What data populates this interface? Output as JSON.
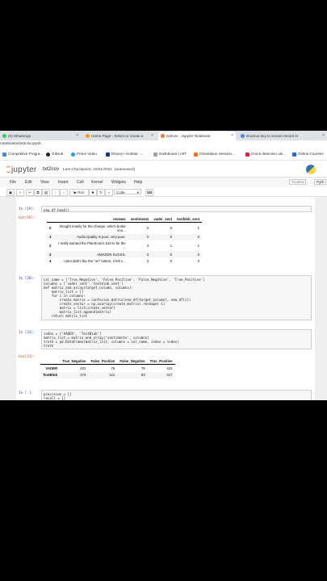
{
  "browser": {
    "tabs": [
      {
        "label": "(6) WhatsApp",
        "color": "#25d366"
      },
      {
        "label": "Home Page - Select or create a",
        "color": "#f59e0b"
      },
      {
        "label": "txt2csv - Jupyter Notebook",
        "color": "#f37626"
      },
      {
        "label": "shortcut key to screen record in",
        "color": "#4285f4"
      }
    ],
    "url": "notebooks/txt2csv.ipynb",
    "bookmarks": [
      {
        "label": "Competitive Progra...",
        "color": "#4285f4"
      },
      {
        "label": "GitHub",
        "color": "#222222"
      },
      {
        "label": "Prime Video",
        "color": "#1a98ff"
      },
      {
        "label": "Disney+ Hotstar -...",
        "color": "#0c3b8c"
      },
      {
        "label": "Dashboard | eIIT",
        "color": "#9ca3af"
      },
      {
        "label": "Orientation Session...",
        "color": "#f97316"
      },
      {
        "label": "Crack detection usi...",
        "color": "#e11d48"
      },
      {
        "label": "Online Courses",
        "color": "#2563eb"
      }
    ]
  },
  "jupyter": {
    "logo": "jupyter",
    "notebook_name": "txt2csv",
    "checkpoint": "Last Checkpoint: 10/01/2021",
    "autosave": "(autosaved)",
    "menus": [
      "File",
      "Edit",
      "View",
      "Insert",
      "Cell",
      "Kernel",
      "Widgets",
      "Help"
    ],
    "trusted": "Trusted",
    "kernel": "Pyth",
    "run_label": "▶ Run",
    "cell_type": "Code"
  },
  "cells": {
    "c19_in": "In [19]:",
    "c19_code": "new_df.head()",
    "c19_out": "Out[19]:",
    "head_table": {
      "columns": [
        "reviews",
        "sentiments",
        "vader_sent",
        "textblob_sent"
      ],
      "rows": [
        {
          "idx": "0",
          "cells": [
            "Bought mainly for the charger, which broke soo...",
            "0",
            "0",
            "1"
          ]
        },
        {
          "idx": "1",
          "cells": [
            "Audio Quality is poor, very poor.",
            "0",
            "0",
            "0"
          ]
        },
        {
          "idx": "2",
          "cells": [
            "I really wanted the Plantronics 510 to be the ...",
            "0",
            "1",
            "1"
          ]
        },
        {
          "idx": "3",
          "cells": [
            "AMAZON SUCKS.",
            "0",
            "0",
            "0"
          ]
        },
        {
          "idx": "4",
          "cells": [
            "I also didn't like the \"on\" button, it felt s...",
            "0",
            "0",
            "0"
          ]
        }
      ]
    },
    "c20_in": "In [20]:",
    "c20_lines": [
      "col_name = ['True_Negative', 'False_Positive', 'False_Negative', 'True_Positive']",
      "columns = ['vader_sent','textblob_sent']",
      "def matrix_and_array(target_column, columns):",
      "    matrix_list = []",
      "    for i in columns:",
      "        create_matrix = confusion_matrix(new_df[target_column], new_df[i])",
      "        create_vector = np.asarray(create_matrix).reshape(-1)",
      "        matrix = list(create_vector)",
      "        matrix_list.append(matrix)",
      "    return matrix_list"
    ],
    "c21_in": "In [21]:",
    "c21_lines": [
      "index = ['VADER', 'TextBlob']",
      "matrix_list = matrix_and_array('sentiments', columns)",
      "truth = pd.DataFrame(matrix_list, columns = col_name, index = index)",
      "truth"
    ],
    "c21_out": "Out[21]:",
    "truth_table": {
      "columns": [
        "True_Negative",
        "False_Positive",
        "False_Negative",
        "True_Positive"
      ],
      "rows": [
        {
          "idx": "VADER",
          "cells": [
            "422",
            "76",
            "78",
            "422"
          ]
        },
        {
          "idx": "TextBlob",
          "cells": [
            "373",
            "121",
            "83",
            "417"
          ]
        }
      ]
    },
    "c_next_in": "In [ ]:",
    "c_next_lines": [
      "precision = []",
      "recall = []"
    ]
  }
}
